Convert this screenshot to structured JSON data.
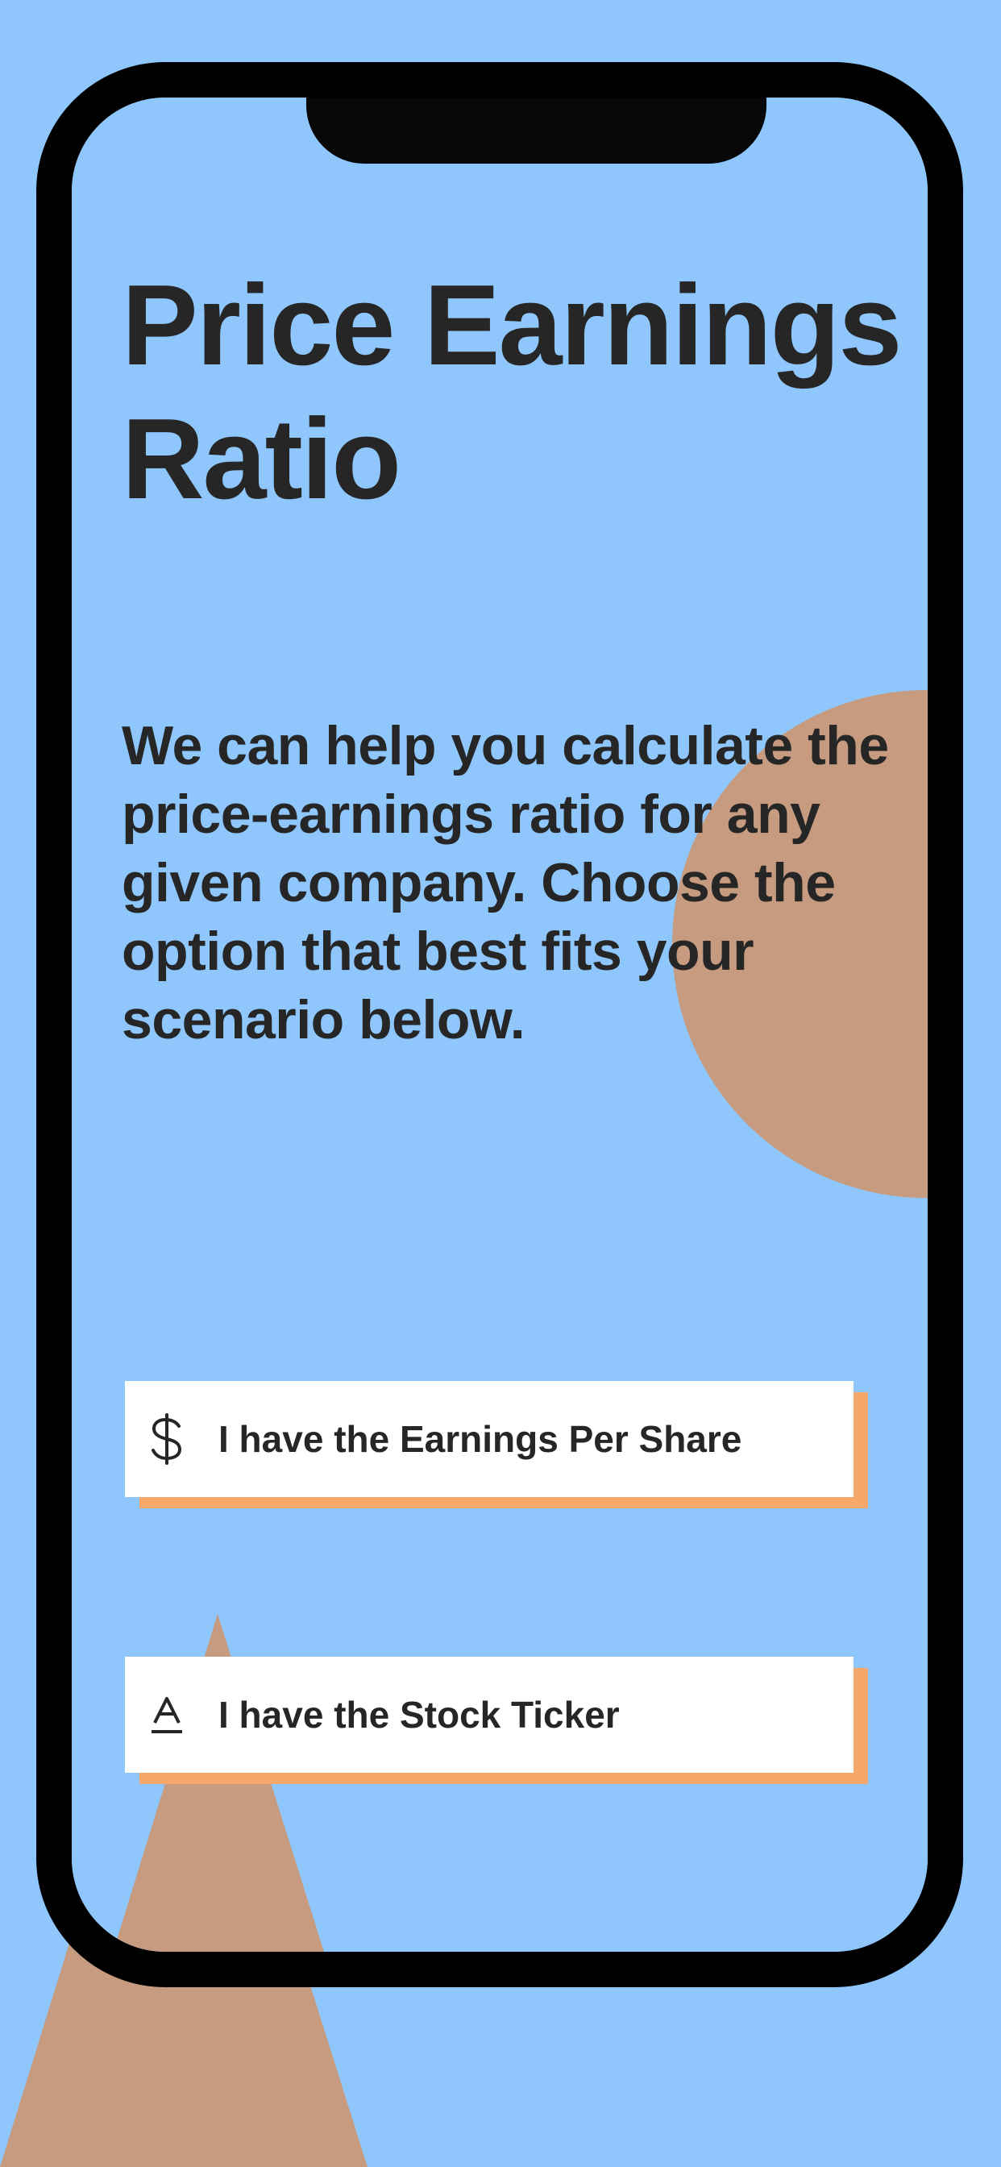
{
  "page": {
    "title": "Price Earnings Ratio",
    "description": "We can help you calculate the price-earnings ratio for any given company. Choose the option that best fits your scenario below."
  },
  "options": [
    {
      "label": "I have the Earnings Per Share",
      "icon": "dollar-icon"
    },
    {
      "label": "I have the Stock Ticker",
      "icon": "text-format-icon"
    }
  ],
  "colors": {
    "background": "#8fc7fd",
    "accent": "#f6a86b",
    "shape": "#c69b7f",
    "text": "#262626"
  }
}
